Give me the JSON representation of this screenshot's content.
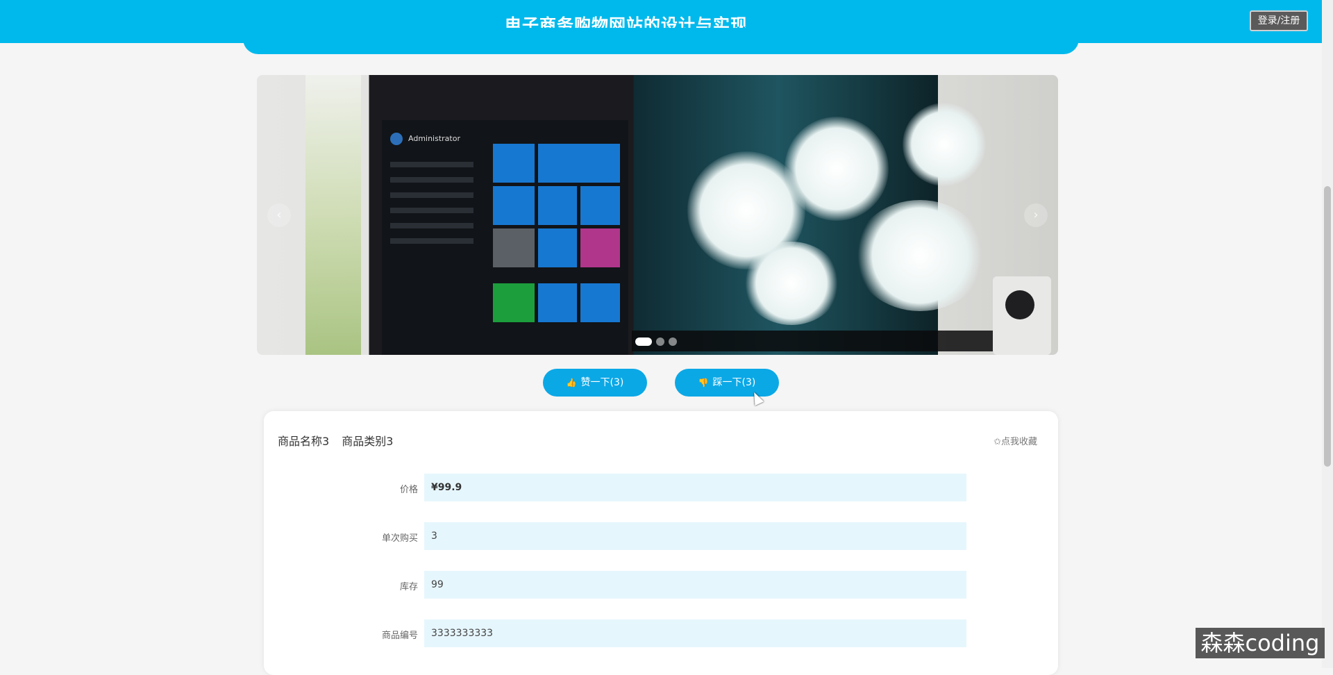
{
  "header": {
    "title": "电子商务购物网站的设计与实现",
    "login_label": "登录/注册",
    "brand_color": "#00b9ec"
  },
  "carousel": {
    "prev_icon": "chevron-left-icon",
    "next_icon": "chevron-right-icon",
    "prev_glyph": "‹",
    "next_glyph": "›",
    "slide_count": 3,
    "active_index": 0,
    "screen": {
      "user_name": "Administrator"
    }
  },
  "votes": {
    "like_label": "赞一下(3)",
    "like_icon": "thumbs-up-icon",
    "dislike_label": "踩一下(3)",
    "dislike_icon": "thumbs-down-icon",
    "button_color": "#0ba8e6"
  },
  "product": {
    "name": "商品名称3",
    "category": "商品类别3",
    "favorite_label": "✩点我收藏",
    "fields": [
      {
        "label": "价格",
        "value": "¥99.9"
      },
      {
        "label": "单次购买",
        "value": "3"
      },
      {
        "label": "库存",
        "value": "99"
      },
      {
        "label": "商品编号",
        "value": "3333333333"
      }
    ]
  },
  "watermark": "森森coding"
}
